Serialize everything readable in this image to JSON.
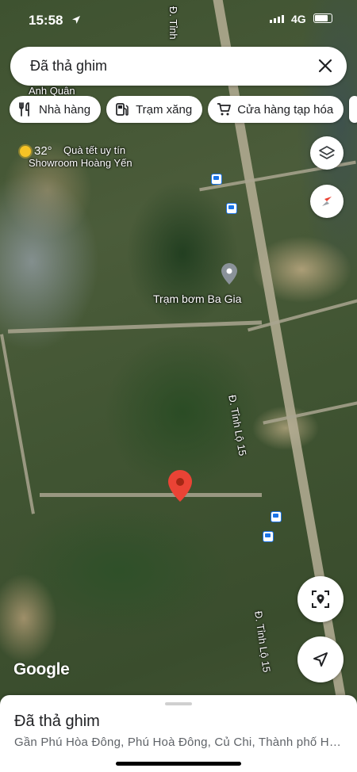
{
  "status_bar": {
    "time": "15:58",
    "network": "4G"
  },
  "search": {
    "query": "Đã thả ghim",
    "close_icon": "close-icon"
  },
  "chips": [
    {
      "label": "Nhà hàng",
      "icon": "restaurant-icon"
    },
    {
      "label": "Trạm xăng",
      "icon": "gas-station-icon"
    },
    {
      "label": "Cửa hàng tạp hóa",
      "icon": "shopping-cart-icon"
    }
  ],
  "map": {
    "weather": {
      "temperature": "32°",
      "icon": "sun-icon"
    },
    "labels": {
      "place_1": "Anh Quân",
      "place_2": "Showroom Hoàng Yến",
      "place_3": "Quà tết uy tín",
      "poi": "Trạm bơm Ba Gia",
      "road_top": "Đ. Tỉnh",
      "road_mid": "Đ. Tỉnh Lộ 15",
      "road_bottom": "Đ. Tỉnh Lộ 15"
    },
    "attribution": "Google"
  },
  "sheet": {
    "title": "Đã thả ghim",
    "address": "Gần Phú Hòa Đông, Phú Hoà Đông, Củ Chi, Thành phố Hồ..."
  },
  "colors": {
    "pin_red": "#ea4335",
    "accent_blue": "#1a73e8"
  }
}
